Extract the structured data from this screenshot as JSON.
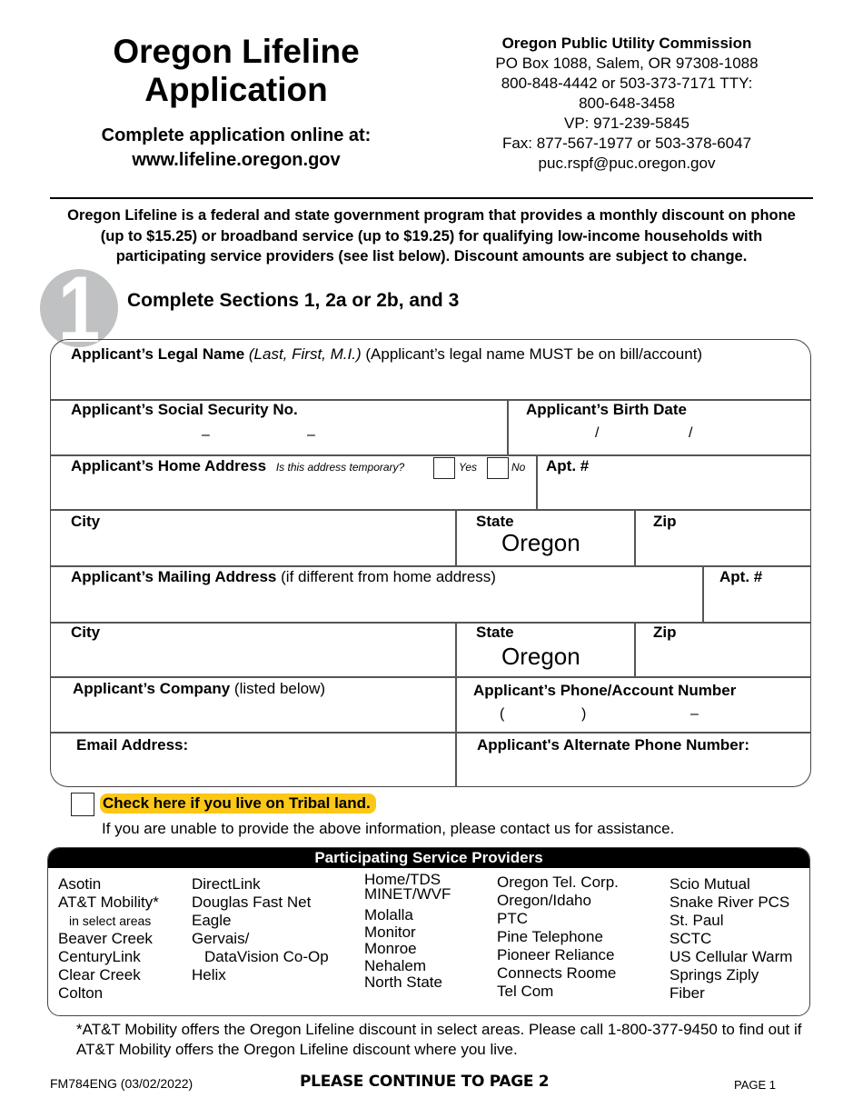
{
  "header": {
    "title_line1": "Oregon Lifeline",
    "title_line2": "Application",
    "online_line1": "Complete application online at:",
    "online_line2": "www.lifeline.oregon.gov"
  },
  "contact": {
    "org": "Oregon Public Utility Commission",
    "address": "PO Box 1088, Salem, OR 97308-1088",
    "phones": "800-848-4442 or 503-373-7171 TTY:",
    "tty": "800-648-3458",
    "vp": "VP: 971-239-5845",
    "fax": "Fax: 877-567-1977 or 503-378-6047",
    "email": "puc.rspf@puc.oregon.gov"
  },
  "intro": "Oregon Lifeline is a federal and state government program that provides a monthly discount on phone (up to $15.25) or broadband service (up to $19.25) for qualifying low-income households with participating service providers (see list below). Discount amounts are subject to change.",
  "section": {
    "number": "1",
    "title": "Complete Sections 1, 2a or 2b, and 3"
  },
  "form": {
    "legal_name": {
      "label": "Applicant’s Legal Name",
      "hint_italic": "(Last, First, M.I.)",
      "hint": "(Applicant’s legal name MUST be on bill/account)"
    },
    "ssn": {
      "label": "Applicant’s Social Security No.",
      "sep1": "–",
      "sep2": "–"
    },
    "birth_date": {
      "label": "Applicant’s Birth Date",
      "sep1": "/",
      "sep2": "/"
    },
    "home_address": {
      "label": "Applicant’s Home Address",
      "temporary_question": "Is this address temporary?",
      "yes": "Yes",
      "no": "No"
    },
    "home_apt": {
      "label": "Apt. #"
    },
    "home_city": {
      "label": "City"
    },
    "home_state": {
      "label": "State",
      "value": "Oregon"
    },
    "home_zip": {
      "label": "Zip"
    },
    "mailing_address": {
      "label": "Applicant’s Mailing Address",
      "hint": "(if different from home address)"
    },
    "mailing_apt": {
      "label": "Apt. #"
    },
    "mailing_city": {
      "label": "City"
    },
    "mailing_state": {
      "label": "State",
      "value": "Oregon"
    },
    "mailing_zip": {
      "label": "Zip"
    },
    "company": {
      "label": "Applicant’s Company",
      "hint": "(listed below)"
    },
    "phone": {
      "label": "Applicant’s Phone/Account Number",
      "open_paren": "(",
      "close_paren": ")",
      "dash": "–"
    },
    "email": {
      "label": "Email Address:"
    },
    "alt_phone": {
      "label": "Applicant's Alternate Phone Number:"
    }
  },
  "tribal": {
    "label": "Check here if you live on Tribal land.",
    "highlight_color": "#fcc716"
  },
  "assistance": "If you are unable to provide the above information, please contact us for assistance.",
  "providers": {
    "heading": "Participating Service Providers",
    "columns": [
      [
        "Asotin",
        "AT&T Mobility*",
        "in select areas",
        "Beaver Creek",
        "CenturyLink",
        "Clear Creek",
        "Colton"
      ],
      [
        "DirectLink",
        "Douglas Fast Net",
        "Eagle",
        "Gervais/",
        "DataVision Co-Op",
        "Helix"
      ],
      [
        "Home/TDS",
        "MINET/WVF",
        "Molalla",
        "Monitor",
        "Monroe",
        "Nehalem",
        "North State"
      ],
      [
        "Oregon Tel. Corp.",
        "Oregon/Idaho",
        "PTC",
        "Pine Telephone",
        "Pioneer Reliance",
        "Connects Roome",
        "Tel Com"
      ],
      [
        "Scio Mutual",
        "Snake River PCS",
        "St. Paul",
        "SCTC",
        "US Cellular Warm",
        "Springs Ziply",
        "Fiber"
      ]
    ]
  },
  "footnote": "*AT&T Mobility offers the Oregon Lifeline discount in select areas. Please call 1-800-377-9450 to find out if AT&T Mobility offers the Oregon Lifeline discount where you live.",
  "footer": {
    "form_id": "FM784ENG (03/02/2022)",
    "continue": "PLEASE CONTINUE TO PAGE 2",
    "page": "PAGE 1"
  }
}
